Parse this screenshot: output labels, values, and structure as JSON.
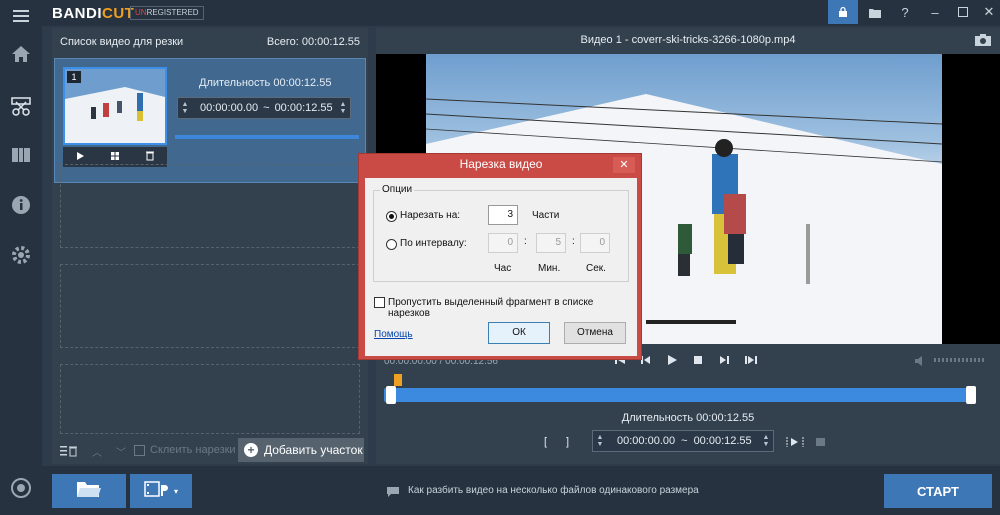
{
  "app": {
    "logo_main": "BANDI",
    "logo_accent": "CUT",
    "badge_u": "UN",
    "badge_rest": "REGISTERED"
  },
  "left_panel": {
    "title": "Список видео для резки",
    "total": "Всего: 00:00:12.55",
    "clip": {
      "number": "1",
      "duration": "Длительность 00:00:12.55",
      "range_start": "00:00:00.00",
      "range_sep": "~",
      "range_end": "00:00:12.55",
      "progress": 1.0
    },
    "merge_label": "Склеить нарезки",
    "add_button": "Добавить участок"
  },
  "video": {
    "title": "Видео 1 - coverr-ski-tricks-3266-1080p.mp4",
    "time_display": "00:00:00.00 / 00:00:12.56",
    "duration": "Длительность 00:00:12.55",
    "range_start": "00:00:00.00",
    "range_sep": "~",
    "range_end": "00:00:12.55"
  },
  "dialog": {
    "title": "Нарезка видео",
    "group": "Опции",
    "cut_into_label": "Нарезать на:",
    "cut_into_value": "3",
    "parts": "Части",
    "interval_label": "По интервалу:",
    "hours_value": "0",
    "minutes_value": "5",
    "seconds_value": "0",
    "colon": ":",
    "hours_unit": "Час",
    "minutes_unit": "Мин.",
    "seconds_unit": "Сек.",
    "skip_label": "Пропустить выделенный фрагмент в списке нарезков",
    "help": "Помощь",
    "ok": "ОК",
    "cancel": "Отмена"
  },
  "bottom": {
    "hint": "Как разбить видео на несколько файлов одинакового размера",
    "start": "СТАРТ"
  },
  "colors": {
    "accent": "#3d86d9",
    "dialog_border": "#ca4a45",
    "start_button": "#3d77b6"
  }
}
